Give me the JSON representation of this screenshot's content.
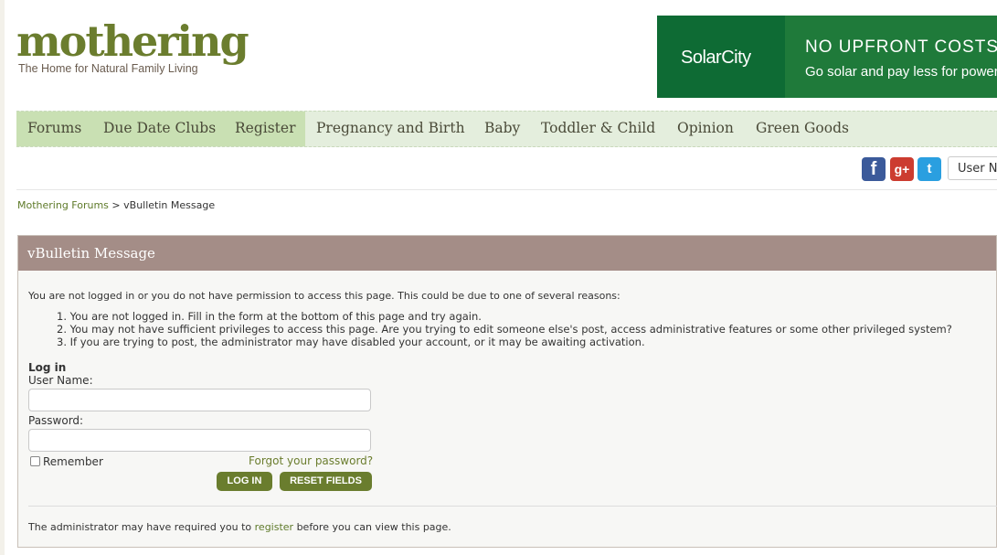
{
  "header": {
    "logo_text": "mothering",
    "tagline": "The Home for Natural Family Living"
  },
  "ad": {
    "brand": "SolarCity",
    "headline": "NO UPFRONT COSTS.",
    "subline": "Go solar and pay less for power"
  },
  "nav": {
    "items": [
      {
        "label": "Forums"
      },
      {
        "label": "Due Date Clubs"
      },
      {
        "label": "Register"
      },
      {
        "label": "Pregnancy and Birth"
      },
      {
        "label": "Baby"
      },
      {
        "label": "Toddler & Child"
      },
      {
        "label": "Opinion"
      },
      {
        "label": "Green Goods"
      }
    ]
  },
  "social": {
    "facebook_glyph": "f",
    "googleplus_glyph": "g+",
    "twitter_glyph": "t",
    "icons": [
      "facebook-icon",
      "google-plus-icon",
      "twitter-icon"
    ]
  },
  "user_box": {
    "text": "User Name"
  },
  "breadcrumb": {
    "home": "Mothering Forums",
    "separator": ">",
    "current": "vBulletin Message"
  },
  "message": {
    "title": "vBulletin Message",
    "intro": "You are not logged in or you do not have permission to access this page. This could be due to one of several reasons:",
    "reasons": [
      "1. You are not logged in. Fill in the form at the bottom of this page and try again.",
      "2. You may not have sufficient privileges to access this page. Are you trying to edit someone else's post, access administrative features or some other privileged system?",
      "3. If you are trying to post, the administrator may have disabled your account, or it may be awaiting activation."
    ],
    "login": {
      "heading": "Log in",
      "username_label": "User Name:",
      "username_value": "",
      "password_label": "Password:",
      "password_value": "",
      "remember_label": "Remember",
      "forgot_label": "Forgot your password?",
      "login_button": "LOG IN",
      "reset_button": "RESET FIELDS"
    },
    "footer": {
      "before": "The administrator may have required you to",
      "link": "register",
      "after": "before you can view this page."
    }
  },
  "colors": {
    "brand_green": "#6b7d2e",
    "nav_bg": "#e4eedd",
    "nav_highlight": "#c9e0b3",
    "message_header": "#a48d87",
    "button": "#6a7d2e"
  }
}
